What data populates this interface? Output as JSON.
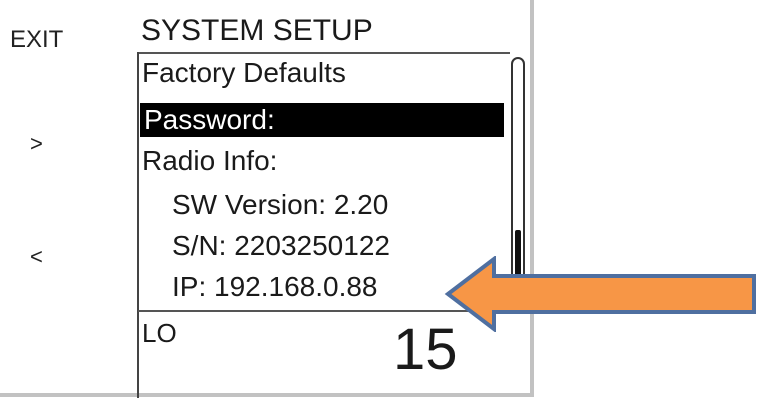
{
  "softkeys": {
    "exit": "EXIT",
    "next": ">",
    "prev": "<"
  },
  "screen": {
    "title": "SYSTEM SETUP",
    "items": [
      {
        "label": "Factory Defaults"
      },
      {
        "label": "Password:"
      },
      {
        "label": "Radio Info:"
      },
      {
        "label": "SW Version: 2.20"
      },
      {
        "label": "S/N: 2203250122"
      },
      {
        "label": "IP: 192.168.0.88"
      }
    ],
    "selected_index": 1,
    "scroll": {
      "thumb_start": 0.7,
      "thumb_end": 0.92
    }
  },
  "status": {
    "label": "LO",
    "value": "15"
  },
  "colors": {
    "arrow_fill": "#F79646",
    "arrow_stroke": "#4F6FA0",
    "selection_bg": "#000000",
    "selection_fg": "#FFFFFF"
  }
}
